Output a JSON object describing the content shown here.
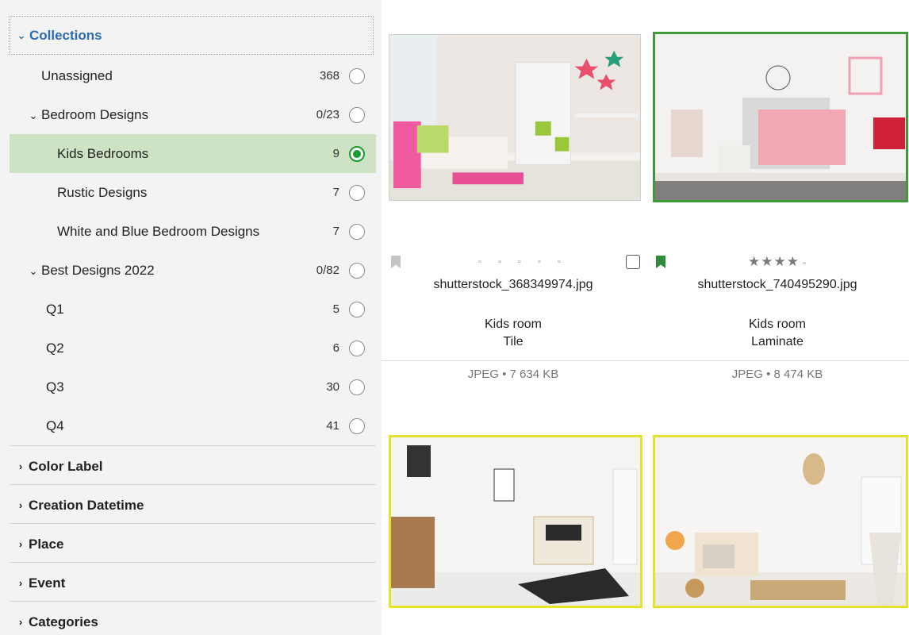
{
  "sidebar": {
    "collections_title": "Collections",
    "items": [
      {
        "label": "Unassigned",
        "count": "368"
      },
      {
        "label": "Bedroom Designs",
        "count": "0/23"
      },
      {
        "label": "Kids Bedrooms",
        "count": "9"
      },
      {
        "label": "Rustic Designs",
        "count": "7"
      },
      {
        "label": "White and Blue Bedroom Designs",
        "count": "7"
      },
      {
        "label": "Best Designs 2022",
        "count": "0/82"
      },
      {
        "label": "Q1",
        "count": "5"
      },
      {
        "label": "Q2",
        "count": "6"
      },
      {
        "label": "Q3",
        "count": "30"
      },
      {
        "label": "Q4",
        "count": "41"
      }
    ],
    "sections": [
      "Color Label",
      "Creation Datetime",
      "Place",
      "Event",
      "Categories"
    ]
  },
  "grid": {
    "cards": [
      {
        "filename": "shutterstock_368349974.jpg",
        "caption_line1": "Kids room",
        "caption_line2": "Tile",
        "file_info": "JPEG • 7 634 KB",
        "rating_empty": "▫ ▫ ▫ ▫ ▫",
        "flagged": false
      },
      {
        "filename": "shutterstock_740495290.jpg",
        "caption_line1": "Kids room",
        "caption_line2": "Laminate",
        "file_info": "JPEG • 8 474 KB",
        "rating_stars": "★★★★",
        "rating_rest": "▫",
        "flagged": true
      }
    ]
  },
  "colors": {
    "accent_blue": "#2b6cb0",
    "selected_row": "#cde3c4",
    "radio_green": "#1a9b2e",
    "thumb_selected_border": "#3f9a3a",
    "thumb_highlight_border": "#e4e22b"
  }
}
